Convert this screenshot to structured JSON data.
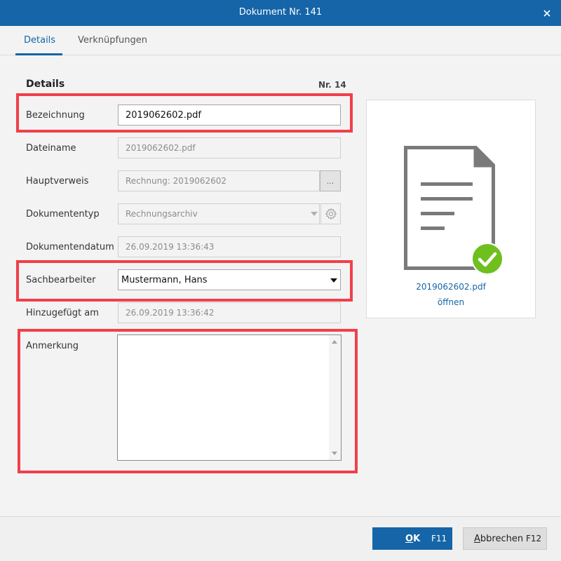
{
  "window": {
    "title": "Dokument Nr. 141",
    "close_icon": "close-icon"
  },
  "tabs": [
    {
      "label": "Details",
      "active": true
    },
    {
      "label": "Verknüpfungen",
      "active": false
    }
  ],
  "details": {
    "heading": "Details",
    "number": "Nr. 14"
  },
  "fields": {
    "bezeichnung": {
      "label": "Bezeichnung",
      "value": "2019062602.pdf"
    },
    "dateiname": {
      "label": "Dateiname",
      "value": "2019062602.pdf"
    },
    "hauptverweis": {
      "label": "Hauptverweis",
      "value": "Rechnung: 2019062602",
      "button_label": "..."
    },
    "dokumententyp": {
      "label": "Dokumententyp",
      "value": "Rechnungsarchiv"
    },
    "dokumentendatum": {
      "label": "Dokumentendatum",
      "value": "26.09.2019 13:36:43"
    },
    "sachbearbeiter": {
      "label": "Sachbearbeiter",
      "value": "Mustermann, Hans"
    },
    "hinzugefuegt": {
      "label": "Hinzugefügt am",
      "value": "26.09.2019 13:36:42"
    },
    "anmerkung": {
      "label": "Anmerkung",
      "value": ""
    }
  },
  "preview": {
    "filename": "2019062602.pdf",
    "open_label": "öffnen",
    "icon": "document-icon",
    "status_icon": "check-circle-icon"
  },
  "footer": {
    "ok_label": "OK",
    "ok_key": "F11",
    "cancel_label": "Abbrechen",
    "cancel_key": "F12"
  },
  "colors": {
    "accent": "#1565a8",
    "highlight": "#f0404a",
    "success": "#6fbf1f"
  }
}
